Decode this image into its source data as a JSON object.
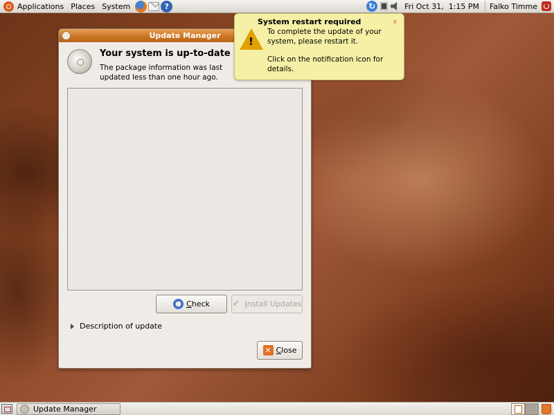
{
  "top_panel": {
    "menus": [
      "Applications",
      "Places",
      "System"
    ],
    "launchers": [
      "firefox-icon",
      "evolution-mail-icon",
      "help-icon"
    ],
    "clock": "Fri Oct 31,  1:15 PM",
    "user": "Falko Timme"
  },
  "window": {
    "title": "Update Manager",
    "heading": "Your system is up-to-date",
    "subtext": "The package information was last updated less than one hour ago.",
    "check_label_prefix": "",
    "check_label_accel": "C",
    "check_label_rest": "heck",
    "install_label_prefix": "",
    "install_label_accel": "I",
    "install_label_rest": "nstall Updates",
    "description_label": "Description of update",
    "close_label_accel": "C",
    "close_label_rest": "lose"
  },
  "notification": {
    "title": "System restart required",
    "line1": "To complete the update of your system, please restart it.",
    "line2": "Click on the notification icon for details.",
    "close_glyph": "x"
  },
  "bottom_panel": {
    "task": "Update Manager"
  },
  "colors": {
    "accent": "#c9731e",
    "notification_bg": "#f5f0a5",
    "warning": "#e2a100"
  }
}
